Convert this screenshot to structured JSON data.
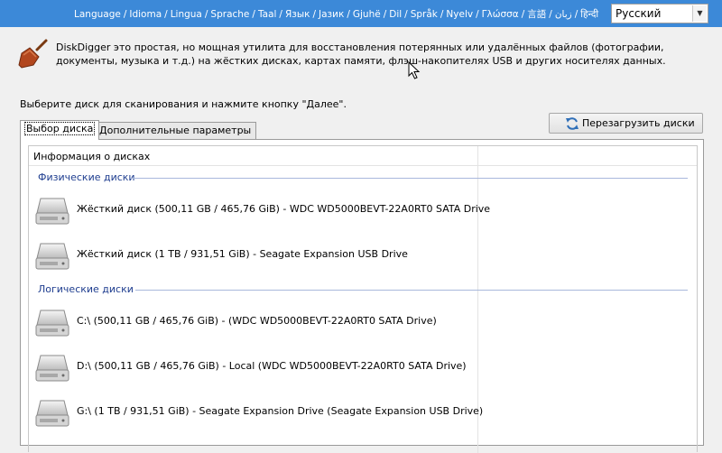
{
  "language_bar": {
    "links": [
      "Language",
      "Idioma",
      "Lingua",
      "Sprache",
      "Taal",
      "Язык",
      "Јазик",
      "Gjuhë",
      "Dil",
      "Språk",
      "Nyelv",
      "Γλώσσα",
      "言語",
      "زبان",
      "हिन्दी"
    ],
    "separator": "/",
    "selected_language": "Русский"
  },
  "intro_text": "DiskDigger это простая, но мощная утилита для восстановления потерянных или удалённых файлов (фотографии, документы, музыка и т.д.) на жёстких дисках, картах памяти, флэш-накопителях USB и других носителях данных.",
  "instruction": "Выберите диск для сканирования и нажмите кнопку \"Далее\".",
  "tabs": [
    {
      "label": "Выбор диска",
      "active": true
    },
    {
      "label": "Дополнительные параметры",
      "active": false
    }
  ],
  "reload_button": "Перезагрузить диски",
  "list": {
    "column_header": "Информация о дисках",
    "groups": [
      {
        "label": "Физические диски",
        "drives": [
          "Жёсткий диск (500,11 GB / 465,76 GiB) - WDC WD5000BEVT-22A0RT0 SATA Drive",
          "Жёсткий диск (1 TB / 931,51 GiB) - Seagate Expansion USB Drive"
        ]
      },
      {
        "label": "Логические диски",
        "drives": [
          "C:\\ (500,11 GB / 465,76 GiB) -  (WDC WD5000BEVT-22A0RT0 SATA Drive)",
          "D:\\ (500,11 GB / 465,76 GiB) - Local (WDC WD5000BEVT-22A0RT0 SATA Drive)",
          "G:\\ (1 TB / 931,51 GiB) - Seagate Expansion Drive (Seagate Expansion USB Drive)"
        ]
      }
    ]
  },
  "colors": {
    "language_bar": "#3c89d8",
    "group_label": "#1e3d8f"
  }
}
